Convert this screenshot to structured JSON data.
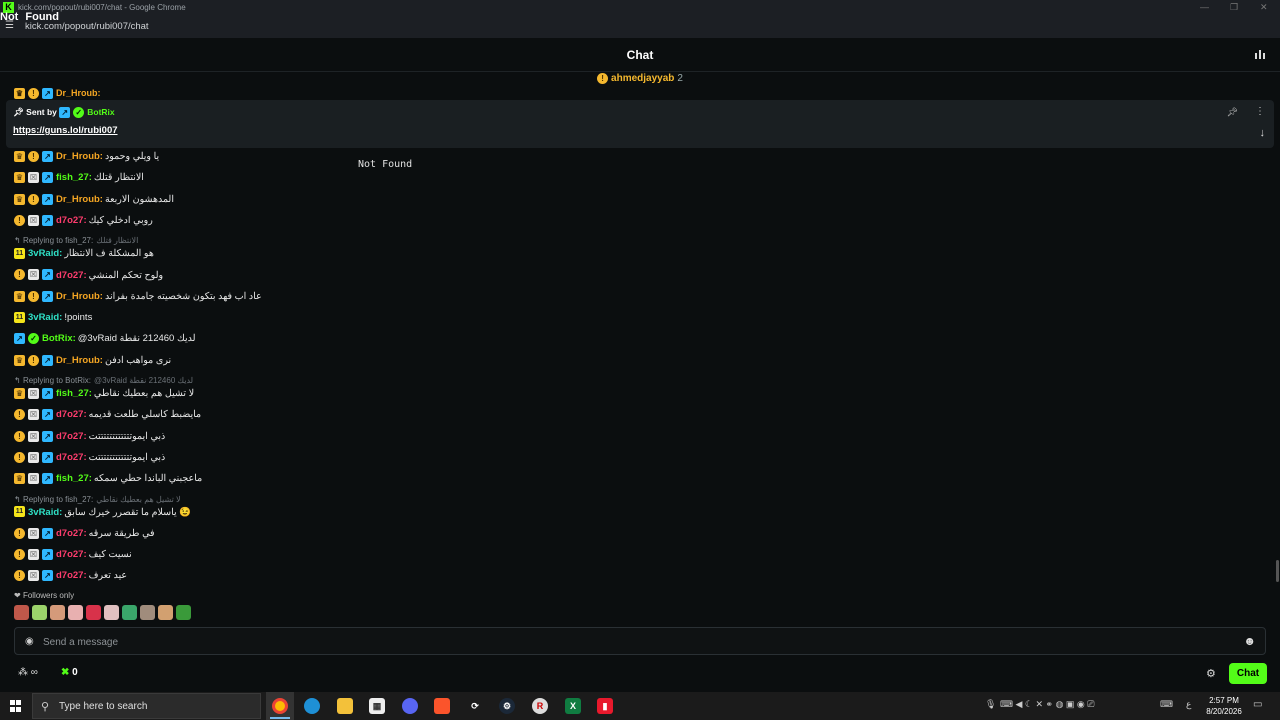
{
  "browser": {
    "window_title": "kick.com/popout/rubi007/chat - Google Chrome",
    "url": "kick.com/popout/rubi007/chat",
    "overlay_text": [
      "Not",
      "Found"
    ]
  },
  "chat": {
    "title": "Chat",
    "top_gifter": {
      "name": "ahmedjayyab",
      "count": "2"
    },
    "cut_off_user": "Dr_Hroub:",
    "pinned": {
      "sent_by": "Sent by",
      "bot_name": "BotRix",
      "link": "https://guns.lol/rubi007"
    },
    "not_found_text": "Not Found",
    "messages": [
      {
        "badges": [
          "crown",
          "coin",
          "arrow"
        ],
        "user": "Dr_Hroub:",
        "color": "orange",
        "text": "يا ويلي وحمود"
      },
      {
        "badges": [
          "crown",
          "box",
          "arrow"
        ],
        "user": "fish_27:",
        "color": "green",
        "text": "الانتظار قتلك"
      },
      {
        "badges": [
          "crown",
          "coin",
          "arrow"
        ],
        "user": "Dr_Hroub:",
        "color": "orange",
        "text": "المدهشون الاربعة"
      },
      {
        "badges": [
          "coin",
          "box",
          "arrow"
        ],
        "user": "d7o27:",
        "color": "pink",
        "text": "روبي ادخلي كيك"
      },
      {
        "reply": "Replying to fish_27:",
        "quote": "الانتظار قتلك"
      },
      {
        "badges": [
          "sub"
        ],
        "user": "3vRaid:",
        "color": "cyan",
        "text": "هو المشكلة ف الانتظار"
      },
      {
        "badges": [
          "coin",
          "box",
          "arrow"
        ],
        "user": "d7o27:",
        "color": "pink",
        "text": "ولوح تحكم المنشي"
      },
      {
        "badges": [
          "crown",
          "coin",
          "arrow"
        ],
        "user": "Dr_Hroub:",
        "color": "orange",
        "text": "عاد اب فهد بتكون شخصيته جامدة بفراند"
      },
      {
        "badges": [
          "sub"
        ],
        "user": "3vRaid:",
        "color": "cyan",
        "text": "!points"
      },
      {
        "badges": [
          "arrow",
          "verified"
        ],
        "user": "BotRix:",
        "color": "green",
        "text": "@3vRaid لديك 212460 نقطة"
      },
      {
        "badges": [
          "crown",
          "coin",
          "arrow"
        ],
        "user": "Dr_Hroub:",
        "color": "orange",
        "text": "نرى مواهب ادفن"
      },
      {
        "reply": "Replying to BotRix:",
        "quote": "@3vRaid لديك 212460 نقطة"
      },
      {
        "badges": [
          "crown",
          "box",
          "arrow"
        ],
        "user": "fish_27:",
        "color": "green",
        "text": "لا تشيل هم بعطيك نقاطي"
      },
      {
        "badges": [
          "coin",
          "box",
          "arrow"
        ],
        "user": "d7o27:",
        "color": "pink",
        "text": "مايضبط كاسلي طلعت قديمه"
      },
      {
        "badges": [
          "coin",
          "box",
          "arrow"
        ],
        "user": "d7o27:",
        "color": "pink",
        "text": "ذبي ايموتتتتتتتتتتتتت"
      },
      {
        "badges": [
          "coin",
          "box",
          "arrow"
        ],
        "user": "d7o27:",
        "color": "pink",
        "text": "ذبي ايموتتتتتتتتتتتتت"
      },
      {
        "badges": [
          "crown",
          "box",
          "arrow"
        ],
        "user": "fish_27:",
        "color": "green",
        "text": "ماعجبني الباندا حطي سمكه"
      },
      {
        "reply": "Replying to fish_27:",
        "quote": "لا تشيل هم بعطيك نقاطي"
      },
      {
        "badges": [
          "sub"
        ],
        "user": "3vRaid:",
        "color": "cyan",
        "text": "ياسلام ما تقصرر خيرك سابق 😉"
      },
      {
        "badges": [
          "coin",
          "box",
          "arrow"
        ],
        "user": "d7o27:",
        "color": "pink",
        "text": "في طريقة سرقه"
      },
      {
        "badges": [
          "coin",
          "box",
          "arrow"
        ],
        "user": "d7o27:",
        "color": "pink",
        "text": "نسيت كيف"
      },
      {
        "badges": [
          "coin",
          "box",
          "arrow"
        ],
        "user": "d7o27:",
        "color": "pink",
        "text": "عيد تعرف"
      }
    ],
    "followers_only": "Followers only",
    "emote_colors": [
      "#c0584a",
      "#9bd36a",
      "#d59a7a",
      "#e8b0b0",
      "#d8324a",
      "#e0c0c0",
      "#3aa66a",
      "#a08c7c",
      "#d2a070",
      "#3a9a3a"
    ],
    "input_placeholder": "Send a message",
    "points_count": "0",
    "chat_button": "Chat"
  },
  "taskbar": {
    "search_placeholder": "Type here to search",
    "time": "2:57 PM",
    "date": "8/20/2026",
    "lang": "ع"
  }
}
